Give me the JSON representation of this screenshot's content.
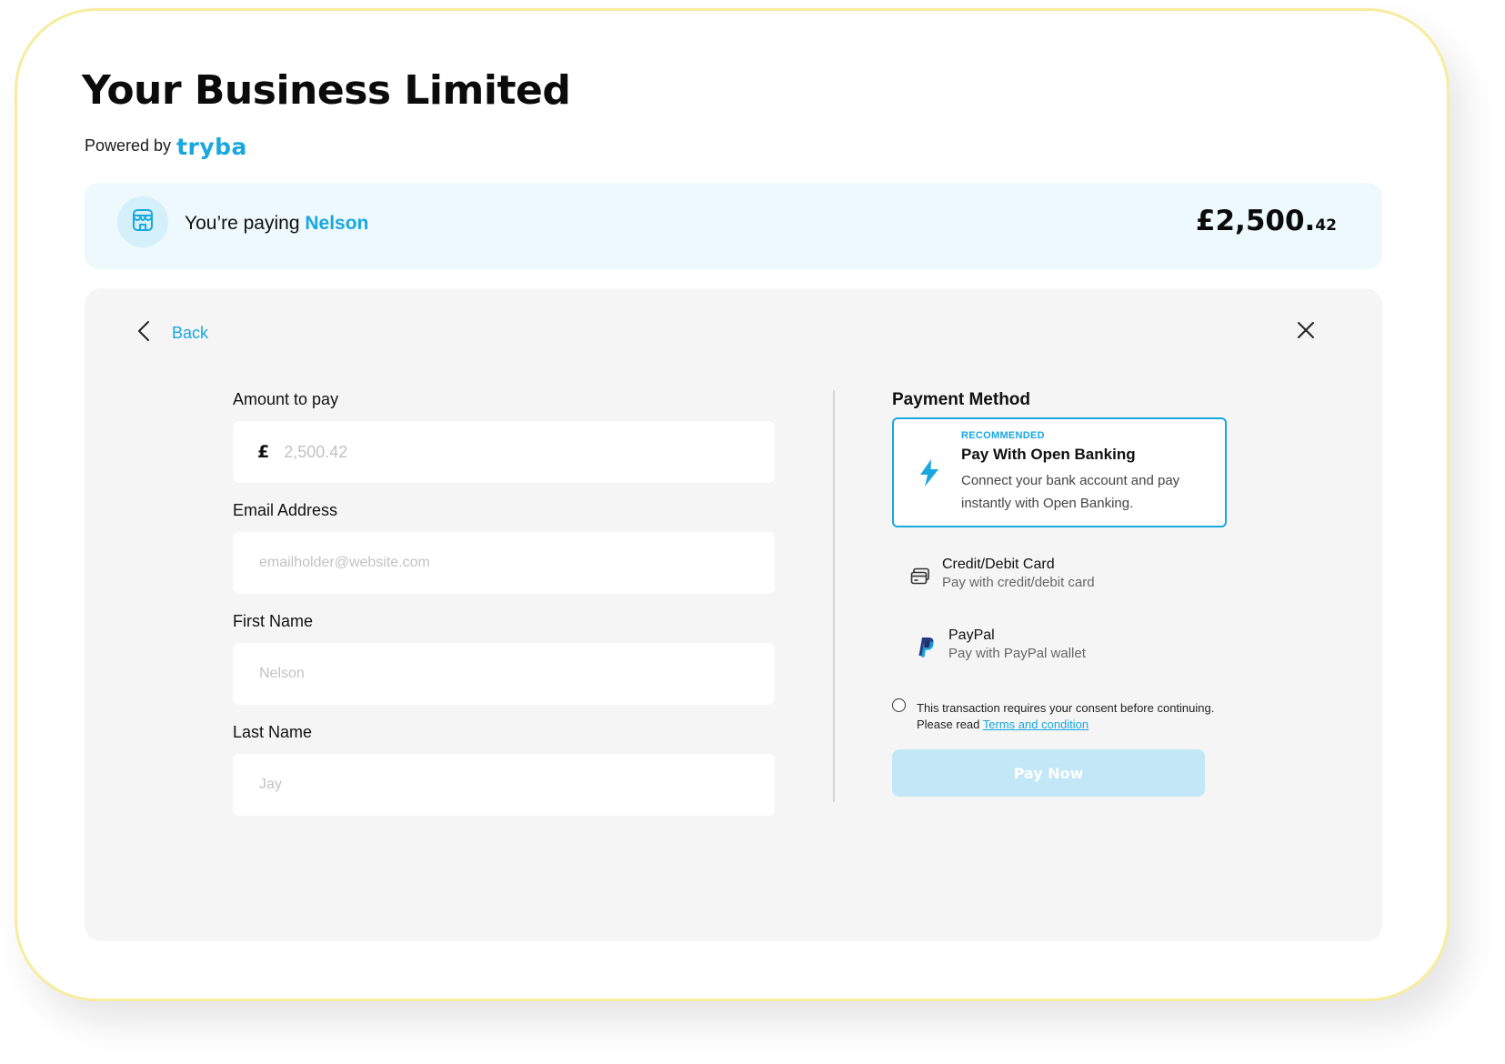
{
  "header": {
    "business_name": "Your Business Limited",
    "powered_by": "Powered by",
    "brand": "tryba"
  },
  "paying": {
    "prefix": "You’re paying",
    "payee": "Nelson",
    "amount_main": "£2,500.",
    "amount_cents": "42"
  },
  "nav": {
    "back_label": "Back"
  },
  "form": {
    "amount": {
      "label": "Amount to pay",
      "currency_symbol": "£",
      "placeholder": "2,500.42"
    },
    "email": {
      "label": "Email Address",
      "placeholder": "emailholder@website.com"
    },
    "first_name": {
      "label": "First Name",
      "placeholder": "Nelson"
    },
    "last_name": {
      "label": "Last Name",
      "placeholder": "Jay"
    }
  },
  "payment": {
    "title": "Payment Method",
    "open_banking": {
      "badge": "RECOMMENDED",
      "title": "Pay With Open Banking",
      "description": "Connect your bank account and pay instantly with Open Banking.",
      "icon": "lightning-bolt-icon",
      "selected": true
    },
    "card": {
      "title": "Credit/Debit Card",
      "subtitle": "Pay with credit/debit card",
      "icon": "credit-card-icon"
    },
    "paypal": {
      "title": "PayPal",
      "subtitle": "Pay with PayPal wallet",
      "icon": "paypal-icon"
    },
    "consent": {
      "text": "This transaction requires your consent before continuing.",
      "read_prefix": "Please read",
      "link": "Terms and condition",
      "checked": false
    },
    "pay_button": "Pay Now"
  },
  "colors": {
    "accent": "#19a7e0",
    "card_border": "#f8ec9f",
    "paying_bar_bg": "#eef9fd",
    "panel_bg": "#f5f5f5",
    "pay_button_disabled": "#c2e7f6"
  }
}
